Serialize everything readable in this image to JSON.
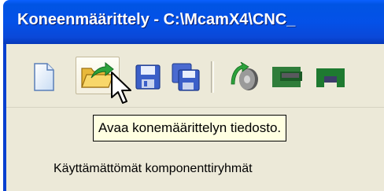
{
  "window": {
    "title": "Koneenmäärittely  - C:\\McamX4\\CNC_"
  },
  "toolbar": {
    "buttons": [
      {
        "icon": "new-file-icon"
      },
      {
        "icon": "open-folder-icon"
      },
      {
        "icon": "save-icon"
      },
      {
        "icon": "save-as-icon"
      },
      {
        "icon": "rotary-axis-icon"
      },
      {
        "icon": "component-group-icon"
      },
      {
        "icon": "spindle-icon"
      }
    ]
  },
  "tooltip": {
    "text": "Avaa konemäärittelyn tiedosto."
  },
  "panel": {
    "unused_groups_label": "Käyttämättömät komponenttiryhmät"
  },
  "colors": {
    "titlebar": "#0054e3",
    "tooltip_bg": "#ffffe1",
    "toolbar_bg": "#ece9d8"
  }
}
